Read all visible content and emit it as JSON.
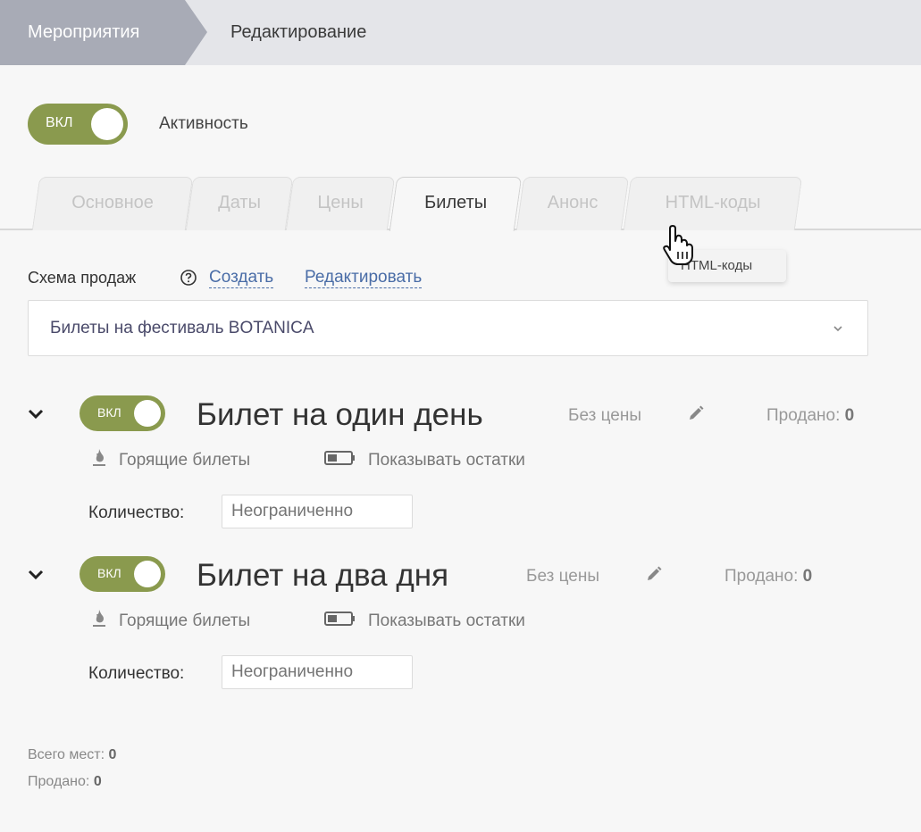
{
  "breadcrumb": {
    "items": [
      "Мероприятия",
      "Редактирование"
    ]
  },
  "activity": {
    "toggle_label": "ВКЛ",
    "label": "Активность"
  },
  "tabs": [
    {
      "label": "Основное",
      "active": false
    },
    {
      "label": "Даты",
      "active": false
    },
    {
      "label": "Цены",
      "active": false
    },
    {
      "label": "Билеты",
      "active": true
    },
    {
      "label": "Анонс",
      "active": false
    },
    {
      "label": "HTML-коды",
      "active": false
    }
  ],
  "tooltip": "HTML-коды",
  "scheme": {
    "label": "Схема продаж",
    "create_link": "Создать",
    "edit_link": "Редактировать",
    "selected": "Билеты на фестиваль BOTANICA"
  },
  "tickets": [
    {
      "toggle_label": "ВКЛ",
      "name": "Билет на один день",
      "price": "Без цены",
      "sold_label": "Продано:",
      "sold_value": "0",
      "hot_label": "Горящие билеты",
      "remains_label": "Показывать остатки",
      "qty_label": "Количество:",
      "qty_placeholder": "Неограниченно"
    },
    {
      "toggle_label": "ВКЛ",
      "name": "Билет на два дня",
      "price": "Без цены",
      "sold_label": "Продано:",
      "sold_value": "0",
      "hot_label": "Горящие билеты",
      "remains_label": "Показывать остатки",
      "qty_label": "Количество:",
      "qty_placeholder": "Неограниченно"
    }
  ],
  "summary": {
    "total_label": "Всего мест:",
    "total_value": "0",
    "sold_label": "Продано:",
    "sold_value": "0"
  },
  "colors": {
    "toggle_on": "#8a9a4e",
    "link": "#4a6da7",
    "breadcrumb_active": "#a8abb6",
    "breadcrumb_bg": "#e4e5e9"
  }
}
